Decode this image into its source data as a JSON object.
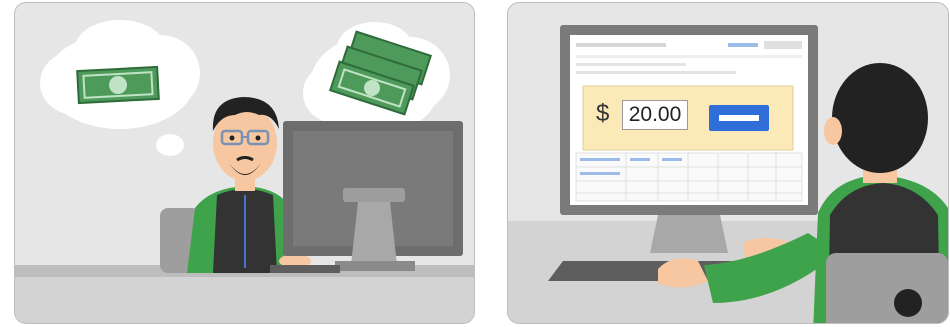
{
  "illustration": {
    "left_panel": {
      "scene": "person-thinking-about-money"
    },
    "right_panel": {
      "scene": "person-entering-bid-amount",
      "currency_symbol": "$",
      "amount_value": "20.00"
    }
  },
  "colors": {
    "panel_bg": "#e6e6e6",
    "money_green": "#4e9a5a",
    "shirt_green": "#3ea34a",
    "dialog_bg": "#fbe9b8",
    "button_blue": "#2f6ed8",
    "skin": "#f6c7a0"
  }
}
